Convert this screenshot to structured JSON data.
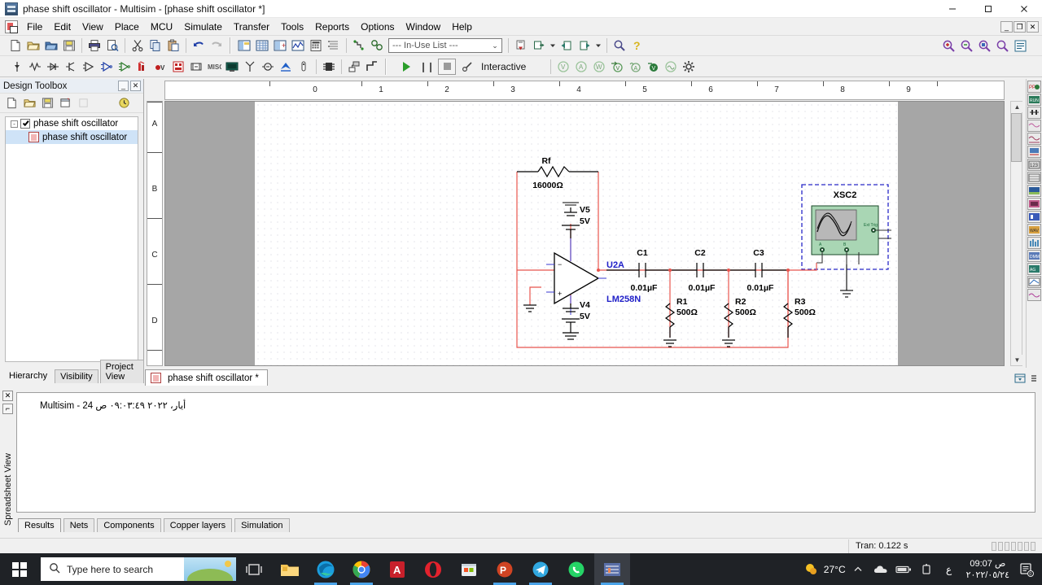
{
  "window": {
    "title": "phase shift oscillator - Multisim - [phase shift oscillator *]",
    "minimize": "–",
    "maximize": "▢",
    "close": "✕"
  },
  "mdi_buttons": {
    "minimize": "_",
    "restore": "❐",
    "close": "✕"
  },
  "menubar": {
    "items": [
      {
        "label": "File"
      },
      {
        "label": "Edit"
      },
      {
        "label": "View"
      },
      {
        "label": "Place"
      },
      {
        "label": "MCU"
      },
      {
        "label": "Simulate"
      },
      {
        "label": "Transfer"
      },
      {
        "label": "Tools"
      },
      {
        "label": "Reports"
      },
      {
        "label": "Options"
      },
      {
        "label": "Window"
      },
      {
        "label": "Help"
      }
    ]
  },
  "standard_toolbar": {
    "icons": [
      "new-document-icon",
      "open-folder-icon",
      "open-design-icon",
      "save-icon",
      "print-icon",
      "print-preview-icon",
      "cut-icon",
      "copy-icon",
      "paste-icon",
      "undo-icon",
      "redo-icon",
      "toggle-design-toolbox-icon",
      "toggle-spreadsheet-view-icon",
      "toggle-sim-switch-icon",
      "grapher-icon",
      "postprocessor-icon",
      "parts-list-icon",
      "electrical-rules-check-icon",
      "capture-screen-area-icon"
    ],
    "in_use_list": {
      "value": "--- In-Use List ---",
      "caret": "⌄"
    },
    "after_list_icons": [
      "back-annotate-icon",
      "forward-annotate-icon",
      "prev-sheet-icon",
      "next-sheet-icon",
      "find-icon",
      "help-icon"
    ],
    "zoom_icons": [
      "zoom-in-icon",
      "zoom-out-icon",
      "zoom-area-icon",
      "zoom-fit-icon",
      "zoom-sheet-icon"
    ]
  },
  "components_toolbar": {
    "icons": [
      "place-source-icon",
      "place-basic-icon",
      "place-diode-icon",
      "place-transistor-icon",
      "place-analog-icon",
      "place-tt l-icon",
      "place-cmos-icon",
      "place-misc-digital-icon",
      "place-mixed-icon",
      "place-indicator-icon",
      "place-power-component-icon",
      "place-misc-icon",
      "place-advanced-peripheral-icon",
      "place-rf-icon",
      "place-electromechanical-icon",
      "place-nimyrio-icon",
      "place-connector-icon",
      "place-mcu-icon",
      "place-hierarchical-block-icon",
      "place-bus-icon"
    ]
  },
  "simulation_toolbar": {
    "run_label": "run-simulation-icon",
    "pause_label": "pause-simulation-icon",
    "stop_label": "stop-simulation-icon",
    "interactive_label": "Interactive",
    "analysis_icons": [
      "dc-operating-point-icon",
      "ac-sweep-icon",
      "transient-icon",
      "dc-sweep-icon",
      "ac-analysis-icon",
      "noise-icon",
      "fourier-icon",
      "analyses-settings-icon"
    ]
  },
  "design_toolbox": {
    "title": "Design Toolbox",
    "header_buttons": {
      "collapse": "_",
      "close": "✕"
    },
    "toolbar_icons": [
      "new-design-icon",
      "open-design-icon",
      "save-design-icon",
      "new-sheet-icon",
      "rename-sheet-icon",
      "history-icon"
    ],
    "tree": [
      {
        "label": "phase shift oscillator",
        "level": 0,
        "icon": "checkbox-checked-icon",
        "expander": "-"
      },
      {
        "label": "phase shift oscillator",
        "level": 1,
        "icon": "schematic-sheet-icon"
      }
    ],
    "tabs": [
      {
        "label": "Hierarchy",
        "active": true
      },
      {
        "label": "Visibility",
        "active": false
      },
      {
        "label": "Project View",
        "active": false
      }
    ]
  },
  "schematic": {
    "h_ruler": [
      "0",
      "1",
      "2",
      "3",
      "4",
      "5",
      "6",
      "7",
      "8",
      "9"
    ],
    "v_ruler": [
      "A",
      "B",
      "C",
      "D"
    ],
    "components": {
      "rf": {
        "ref": "Rf",
        "value": "16000Ω"
      },
      "v5": {
        "ref": "V5",
        "value": "5V"
      },
      "v4": {
        "ref": "V4",
        "value": "5V"
      },
      "opamp": {
        "ref": "U2A",
        "part": "LM258N"
      },
      "c1": {
        "ref": "C1",
        "value": "0.01µF"
      },
      "c2": {
        "ref": "C2",
        "value": "0.01µF"
      },
      "c3": {
        "ref": "C3",
        "value": "0.01µF"
      },
      "r1": {
        "ref": "R1",
        "value": "500Ω"
      },
      "r2": {
        "ref": "R2",
        "value": "500Ω"
      },
      "r3": {
        "ref": "R3",
        "value": "500Ω"
      },
      "scope": {
        "ref": "XSC2",
        "terminal_a": "A",
        "terminal_b": "B",
        "terminal_ext": "Ext Trig"
      }
    },
    "colors": {
      "wire": "#e03c3c",
      "component": "#000000",
      "label": "#1414c8",
      "scope_body": "#a8d5b0",
      "scope_screen": "#b9b9b9",
      "scope_outline": "#2020c0"
    }
  },
  "document_tabs": [
    {
      "label": "phase shift oscillator *",
      "icon": "schematic-sheet-icon",
      "active": true
    }
  ],
  "spreadsheet_view": {
    "side_label": "Spreadsheet View",
    "close_button": "✕",
    "row_text": "Multisim  -  24 أيار، ٢٠٢٢ ٠٩:٠٣:٤٩ ص",
    "tabs": [
      {
        "label": "Results",
        "active": true
      },
      {
        "label": "Nets",
        "active": false
      },
      {
        "label": "Components",
        "active": false
      },
      {
        "label": "Copper layers",
        "active": false
      },
      {
        "label": "Simulation",
        "active": false
      }
    ]
  },
  "statusbar": {
    "left": "",
    "center": "",
    "tran": "Tran: 0.122 s"
  },
  "taskbar": {
    "start_icon": "windows-start-icon",
    "search_placeholder": "Type here to search",
    "search_icon": "search-icon",
    "task_view_icon": "task-view-icon",
    "pinned": [
      {
        "name": "file-explorer-icon"
      },
      {
        "name": "microsoft-edge-icon"
      },
      {
        "name": "google-chrome-icon"
      },
      {
        "name": "adobe-acrobat-icon"
      },
      {
        "name": "opera-icon"
      },
      {
        "name": "microsoft-store-icon"
      },
      {
        "name": "powerpoint-icon"
      },
      {
        "name": "telegram-icon"
      },
      {
        "name": "whatsapp-icon"
      },
      {
        "name": "multisim-icon"
      }
    ],
    "weather": {
      "icon": "sunny-icon",
      "temperature": "27°C"
    },
    "tray_icons": [
      "show-hidden-icons-chevron",
      "onedrive-icon",
      "battery-icon",
      "network-icon",
      "language-icon"
    ],
    "clock": {
      "time": "09:07 ص",
      "date": "٢٠٢٢/٠٥/٢٤"
    },
    "notification_icon": "notification-center-icon"
  }
}
